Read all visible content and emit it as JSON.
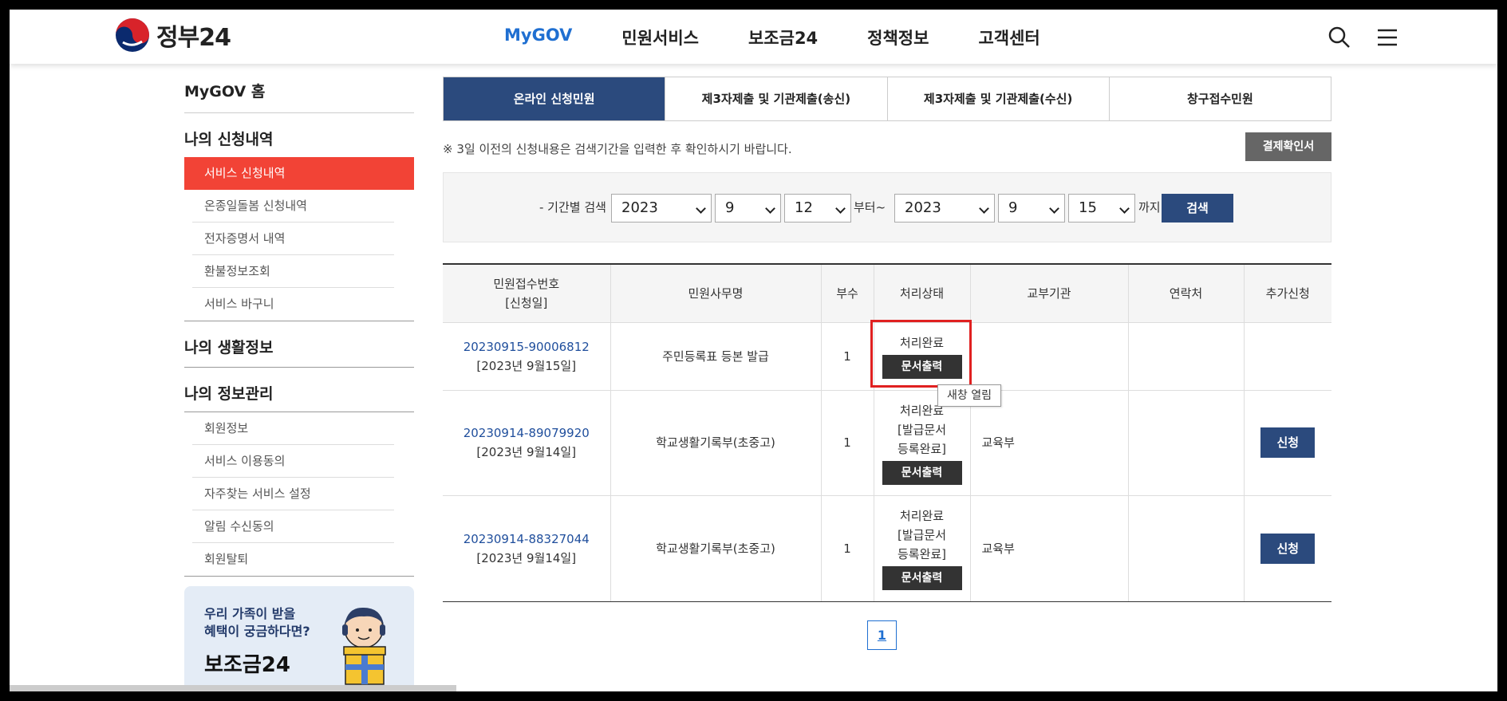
{
  "header": {
    "logo_text": "정부24",
    "nav": [
      "MyGOV",
      "민원서비스",
      "보조금24",
      "정책정보",
      "고객센터"
    ],
    "active_nav": "MyGOV"
  },
  "sidebar": {
    "home": "MyGOV 홈",
    "sections": [
      {
        "title": "나의 신청내역",
        "items": [
          "서비스 신청내역",
          "온종일돌봄 신청내역",
          "전자증명서 내역",
          "환불정보조회",
          "서비스 바구니"
        ]
      },
      {
        "title": "나의 생활정보",
        "items": []
      },
      {
        "title": "나의 정보관리",
        "items": [
          "회원정보",
          "서비스 이용동의",
          "자주찾는 서비스 설정",
          "알림 수신동의",
          "회원탈퇴"
        ]
      }
    ],
    "active_item": "서비스 신청내역",
    "banner": {
      "line1": "우리 가족이 받을",
      "line2": "혜택이 궁금하다면?",
      "title": "보조금24"
    }
  },
  "tabs": [
    "온라인 신청민원",
    "제3자제출 및 기관제출(송신)",
    "제3자제출 및 기관제출(수신)",
    "창구접수민원"
  ],
  "notice": "※ 3일 이전의 신청내용은 검색기간을 입력한 후 확인하시기 바랍니다.",
  "receipt_button": "결제확인서",
  "search": {
    "label": "- 기간별 검색",
    "from": {
      "year": "2023",
      "month": "9",
      "day": "12"
    },
    "from_suffix": "부터~",
    "to": {
      "year": "2023",
      "month": "9",
      "day": "15"
    },
    "to_suffix": "까지",
    "button": "검색"
  },
  "table": {
    "headers": [
      "민원접수번호",
      "[신청일]",
      "민원사무명",
      "부수",
      "처리상태",
      "교부기관",
      "연락처",
      "추가신청"
    ],
    "rows": [
      {
        "number": "20230915-90006812",
        "date": "[2023년 9월15일]",
        "name": "주민등록표 등본 발급",
        "copies": "1",
        "status": [
          "처리완료"
        ],
        "print": "문서출력",
        "org": "",
        "contact": "",
        "apply": ""
      },
      {
        "number": "20230914-89079920",
        "date": "[2023년 9월14일]",
        "name": "학교생활기록부(초중고)",
        "copies": "1",
        "status": [
          "처리완료",
          "[발급문서",
          "등록완료]"
        ],
        "print": "문서출력",
        "org": "교육부",
        "contact": "",
        "apply": "신청"
      },
      {
        "number": "20230914-88327044",
        "date": "[2023년 9월14일]",
        "name": "학교생활기록부(초중고)",
        "copies": "1",
        "status": [
          "처리완료",
          "[발급문서",
          "등록완료]"
        ],
        "print": "문서출력",
        "org": "교육부",
        "contact": "",
        "apply": "신청"
      }
    ]
  },
  "tooltip": "새창 열림",
  "pagination": {
    "current": "1"
  },
  "colors": {
    "accent": "#2b4a7d",
    "active_menu": "#f24336",
    "highlight": "#e02020",
    "nav_active": "#1f6fd1"
  }
}
